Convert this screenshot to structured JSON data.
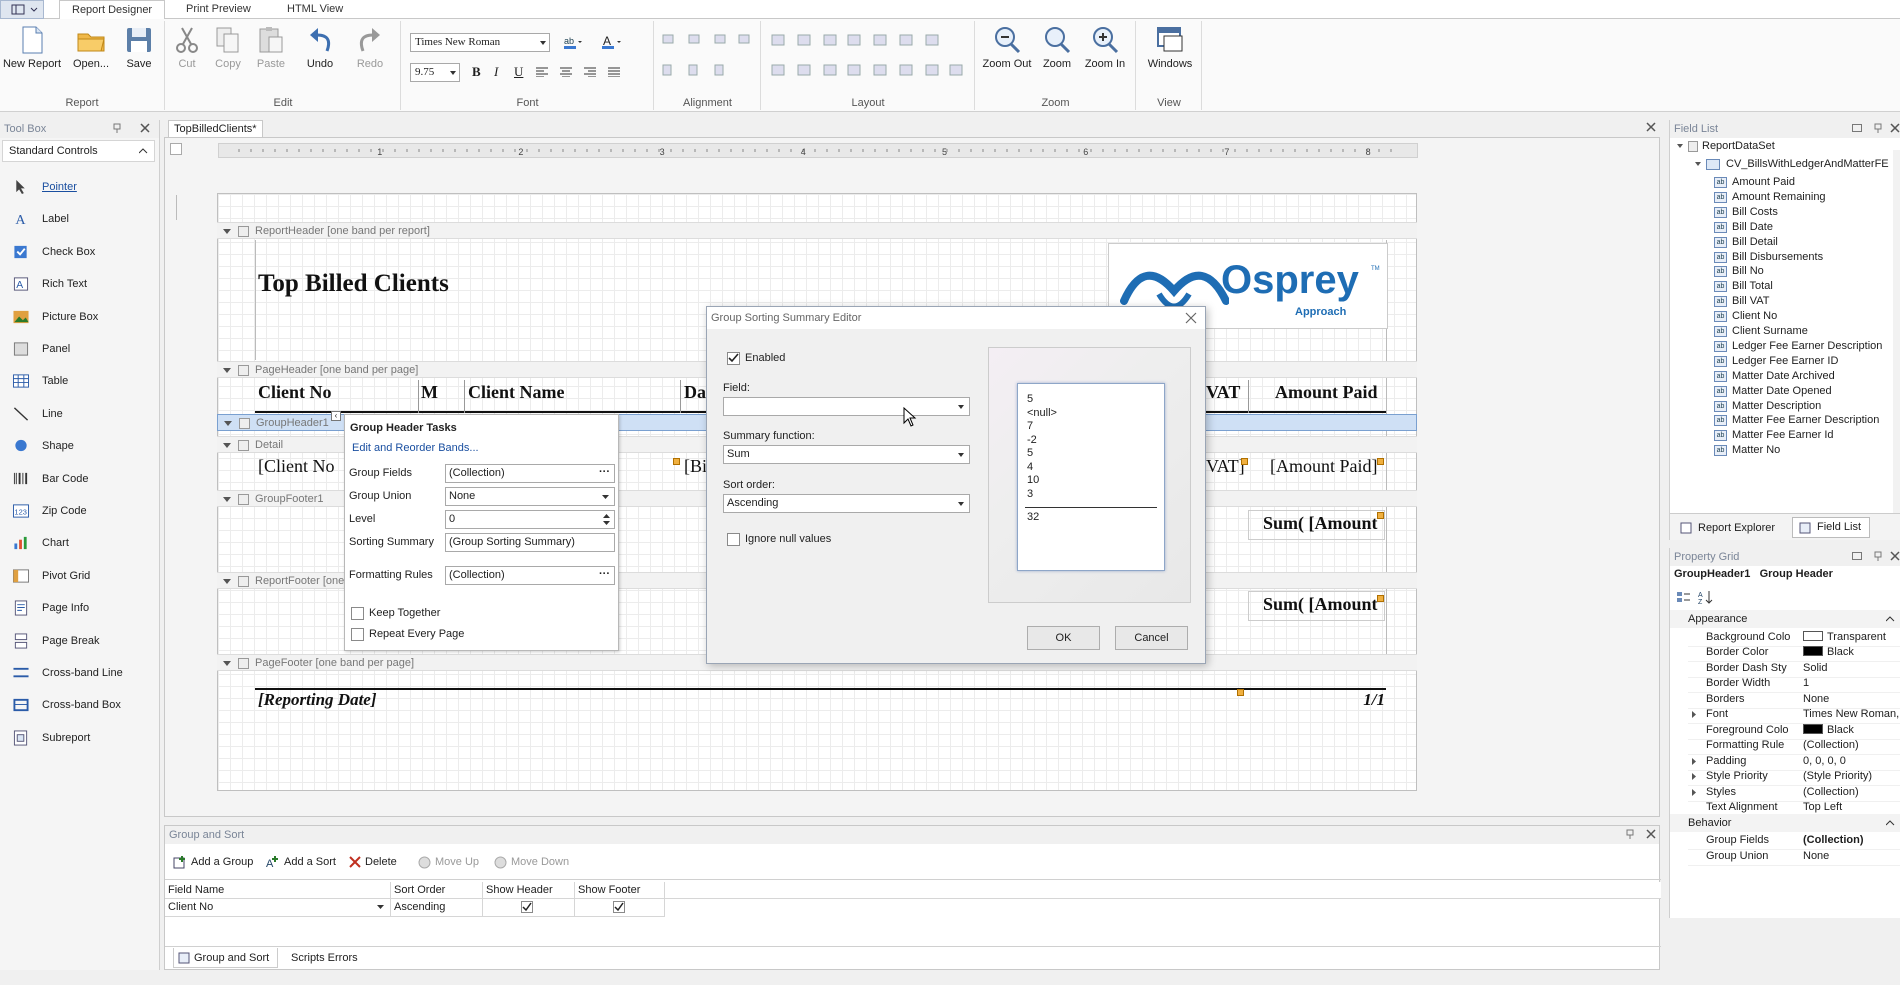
{
  "ribbon": {
    "tabs": [
      "Report Designer",
      "Print Preview",
      "HTML View"
    ],
    "groups": {
      "report": {
        "label": "Report",
        "buttons": [
          "New Report",
          "Open...",
          "Save"
        ]
      },
      "edit": {
        "label": "Edit",
        "buttons": [
          "Cut",
          "Copy",
          "Paste",
          "Undo",
          "Redo"
        ]
      },
      "font": {
        "label": "Font",
        "font_name": "Times New Roman",
        "font_size": "9.75"
      },
      "alignment": {
        "label": "Alignment"
      },
      "layout": {
        "label": "Layout"
      },
      "zoom": {
        "label": "Zoom",
        "buttons": [
          "Zoom Out",
          "Zoom",
          "Zoom In"
        ]
      },
      "view": {
        "label": "View",
        "buttons": [
          "Windows"
        ]
      }
    }
  },
  "toolbox": {
    "title": "Tool Box",
    "category": "Standard Controls",
    "items": [
      "Pointer",
      "Label",
      "Check Box",
      "Rich Text",
      "Picture Box",
      "Panel",
      "Table",
      "Line",
      "Shape",
      "Bar Code",
      "Zip Code",
      "Chart",
      "Pivot Grid",
      "Page Info",
      "Page Break",
      "Cross-band Line",
      "Cross-band Box",
      "Subreport"
    ]
  },
  "designer": {
    "doc_tab": "TopBilledClients*",
    "ruler_marks": [
      "1",
      "2",
      "3",
      "4",
      "5",
      "6",
      "7",
      "8"
    ],
    "bands": {
      "report_header": "ReportHeader [one band per report]",
      "page_header": "PageHeader [one band per page]",
      "group_header": "GroupHeader1",
      "detail": "Detail",
      "group_footer": "GroupFooter1",
      "report_footer": "ReportFooter [one",
      "page_footer": "PageFooter [one band per page]"
    },
    "report_title": "Top Billed Clients",
    "logo_text": "Osprey",
    "logo_sub": "Approach",
    "logo_tm": "TM",
    "header_cells": [
      "Client No",
      "M",
      "Client Name",
      "Da",
      "VAT",
      "Amount Paid"
    ],
    "detail_cells": [
      "[Client No",
      "[Bi",
      "VAT]",
      "[Amount Paid]"
    ],
    "group_footer_sum": "Sum( [Amount",
    "report_footer_sum": "Sum( [Amount",
    "page_footer_left": "[Reporting Date]",
    "page_footer_right": "1/1"
  },
  "group_tasks": {
    "title": "Group Header Tasks",
    "link": "Edit and Reorder Bands...",
    "props": [
      {
        "label": "Group Fields",
        "value": "(Collection)",
        "kind": "ellipsis"
      },
      {
        "label": "Group Union",
        "value": "None",
        "kind": "combo"
      },
      {
        "label": "Level",
        "value": "0",
        "kind": "spin"
      },
      {
        "label": "Sorting Summary",
        "value": "(Group Sorting Summary)",
        "kind": "text"
      },
      {
        "label": "Formatting Rules",
        "value": "(Collection)",
        "kind": "ellipsis"
      }
    ],
    "checks": [
      "Keep Together",
      "Repeat Every Page"
    ]
  },
  "dialog": {
    "title": "Group Sorting Summary Editor",
    "enabled_label": "Enabled",
    "field_label": "Field:",
    "field_value": "",
    "summary_label": "Summary function:",
    "summary_value": "Sum",
    "sort_label": "Sort order:",
    "sort_value": "Ascending",
    "ignore_null_label": "Ignore null values",
    "preview_values": [
      "5",
      "<null>",
      "7",
      "-2",
      "5",
      "4",
      "10",
      "3"
    ],
    "preview_total": "32",
    "ok_label": "OK",
    "cancel_label": "Cancel"
  },
  "field_list": {
    "title": "Field List",
    "root": "ReportDataSet",
    "table": "CV_BillsWithLedgerAndMatterFE",
    "fields": [
      "Amount Paid",
      "Amount Remaining",
      "Bill Costs",
      "Bill Date",
      "Bill Detail",
      "Bill Disbursements",
      "Bill No",
      "Bill Total",
      "Bill VAT",
      "Client No",
      "Client Surname",
      "Ledger Fee Earner Description",
      "Ledger Fee Earner ID",
      "Matter Date Archived",
      "Matter Date Opened",
      "Matter Description",
      "Matter Fee Earner Description",
      "Matter Fee Earner Id",
      "Matter No"
    ],
    "field_icon": "ab",
    "tabs": [
      "Report Explorer",
      "Field List"
    ]
  },
  "property_grid": {
    "title": "Property Grid",
    "selected": "GroupHeader1",
    "selected_type": "Group Header",
    "categories": [
      {
        "name": "Appearance",
        "rows": [
          {
            "k": "Background Colo",
            "v": "Transparent",
            "swatch": "#ffffff"
          },
          {
            "k": "Border Color",
            "v": "Black",
            "swatch": "#000000"
          },
          {
            "k": "Border Dash Sty",
            "v": "Solid"
          },
          {
            "k": "Border Width",
            "v": "1"
          },
          {
            "k": "Borders",
            "v": "None"
          },
          {
            "k": "Font",
            "v": "Times New Roman,...",
            "expand": true
          },
          {
            "k": "Foreground Colo",
            "v": "Black",
            "swatch": "#000000"
          },
          {
            "k": "Formatting Rule",
            "v": "(Collection)"
          },
          {
            "k": "Padding",
            "v": "0, 0, 0, 0",
            "expand": true
          },
          {
            "k": "Style Priority",
            "v": "(Style Priority)",
            "expand": true
          },
          {
            "k": "Styles",
            "v": "(Collection)",
            "expand": true
          },
          {
            "k": "Text Alignment",
            "v": "Top Left"
          }
        ]
      },
      {
        "name": "Behavior",
        "rows": [
          {
            "k": "Group Fields",
            "v": "(Collection)",
            "bold": true
          },
          {
            "k": "Group Union",
            "v": "None"
          }
        ]
      }
    ]
  },
  "group_sort": {
    "title": "Group and Sort",
    "buttons": [
      {
        "label": "Add a Group",
        "disabled": false
      },
      {
        "label": "Add a Sort",
        "disabled": false
      },
      {
        "label": "Delete",
        "disabled": false
      },
      {
        "label": "Move Up",
        "disabled": true
      },
      {
        "label": "Move Down",
        "disabled": true
      }
    ],
    "columns": [
      "Field Name",
      "Sort Order",
      "Show Header",
      "Show Footer"
    ],
    "row": {
      "field": "Client No",
      "sort": "Ascending",
      "show_header": true,
      "show_footer": true
    },
    "bottom_tabs": [
      "Group and Sort",
      "Scripts Errors"
    ]
  },
  "colors": {
    "accent": "#1a4fa0",
    "logo_blue": "#1e6db4",
    "handle": "#f0b040",
    "selection": "#cfe0f5"
  }
}
